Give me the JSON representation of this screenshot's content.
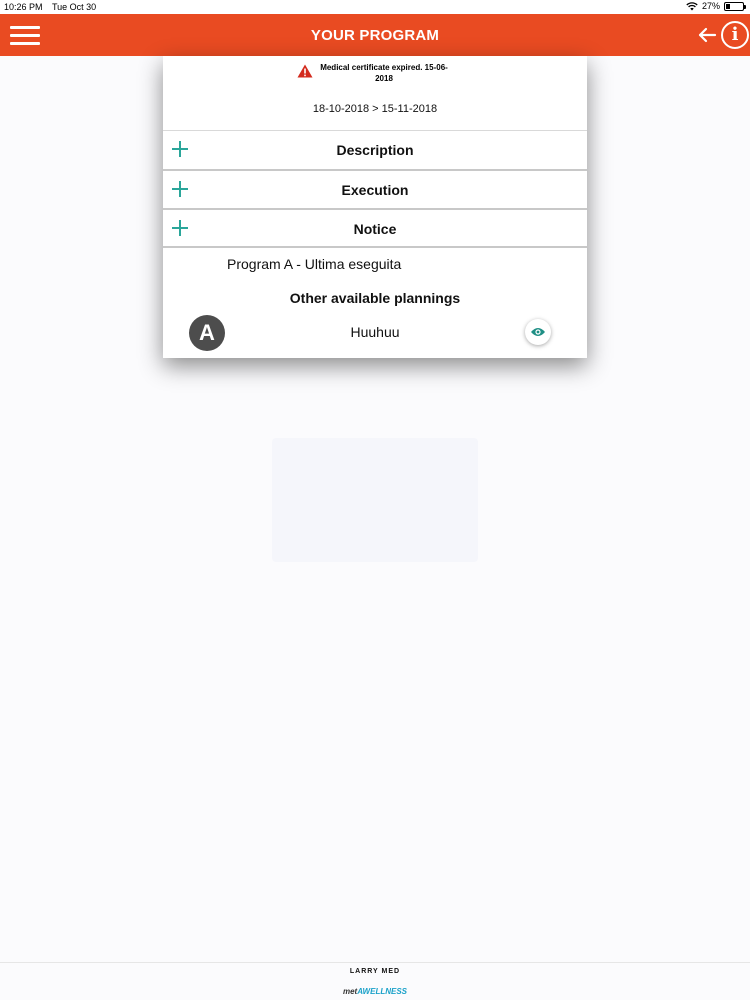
{
  "status_bar": {
    "time": "10:26 PM",
    "date": "Tue Oct 30",
    "battery": "27%",
    "battery_level": 0.27
  },
  "header": {
    "title": "YOUR PROGRAM",
    "color": "#e94b22"
  },
  "program": {
    "warning": "Medical certificate expired. 15-06-2018",
    "dates": "18-10-2018 > 15-11-2018",
    "sections": [
      {
        "label": "Description"
      },
      {
        "label": "Execution"
      },
      {
        "label": "Notice"
      }
    ],
    "current_program": "Program A - Ultima eseguita",
    "other_title": "Other available plannings",
    "plannings": [
      {
        "badge": "A",
        "name": "Huuhuu"
      }
    ]
  },
  "footer": {
    "brand_top": "LARRY MED",
    "brand_bottom_prefix": "met",
    "brand_bottom": "AWELLNESS"
  },
  "colors": {
    "accent": "#e94b22",
    "teal": "#2aa69a",
    "avatar": "#4d4d4d"
  }
}
